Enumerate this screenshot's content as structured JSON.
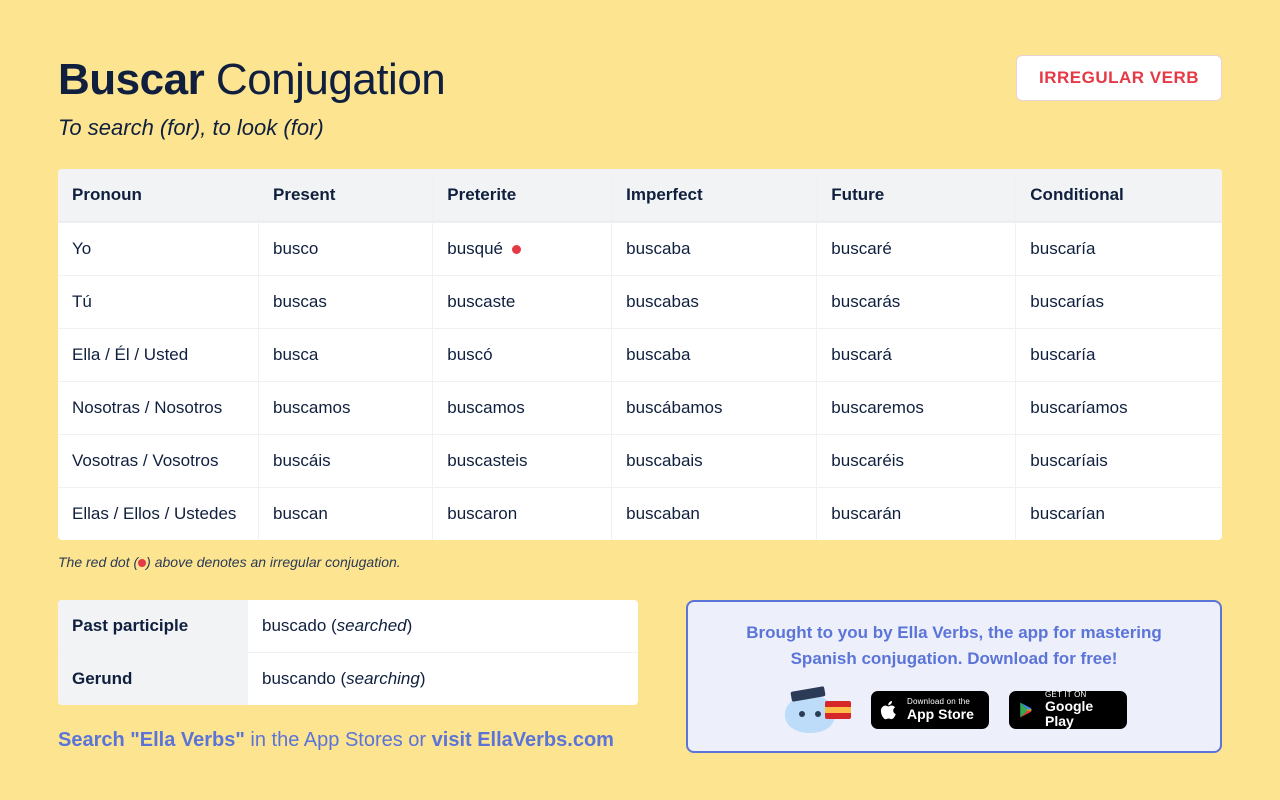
{
  "header": {
    "verb": "Buscar",
    "title_suffix": "Conjugation",
    "subtitle": "To search (for), to look (for)",
    "badge": "IRREGULAR VERB"
  },
  "table": {
    "headers": [
      "Pronoun",
      "Present",
      "Preterite",
      "Imperfect",
      "Future",
      "Conditional"
    ],
    "rows": [
      {
        "pronoun": "Yo",
        "present": "busco",
        "preterite": "busqué",
        "preterite_irregular": true,
        "imperfect": "buscaba",
        "future": "buscaré",
        "conditional": "buscaría"
      },
      {
        "pronoun": "Tú",
        "present": "buscas",
        "preterite": "buscaste",
        "preterite_irregular": false,
        "imperfect": "buscabas",
        "future": "buscarás",
        "conditional": "buscarías"
      },
      {
        "pronoun": "Ella / Él / Usted",
        "present": "busca",
        "preterite": "buscó",
        "preterite_irregular": false,
        "imperfect": "buscaba",
        "future": "buscará",
        "conditional": "buscaría"
      },
      {
        "pronoun": "Nosotras / Nosotros",
        "present": "buscamos",
        "preterite": "buscamos",
        "preterite_irregular": false,
        "imperfect": "buscábamos",
        "future": "buscaremos",
        "conditional": "buscaríamos"
      },
      {
        "pronoun": "Vosotras / Vosotros",
        "present": "buscáis",
        "preterite": "buscasteis",
        "preterite_irregular": false,
        "imperfect": "buscabais",
        "future": "buscaréis",
        "conditional": "buscaríais"
      },
      {
        "pronoun": "Ellas / Ellos / Ustedes",
        "present": "buscan",
        "preterite": "buscaron",
        "preterite_irregular": false,
        "imperfect": "buscaban",
        "future": "buscarán",
        "conditional": "buscarían"
      }
    ]
  },
  "footnote": {
    "before": "The red dot (",
    "after": ") above denotes an irregular conjugation."
  },
  "forms": {
    "past_participle_label": "Past participle",
    "past_participle_value": "buscado",
    "past_participle_translation": "searched",
    "gerund_label": "Gerund",
    "gerund_value": "buscando",
    "gerund_translation": "searching"
  },
  "promo": {
    "line1": "Brought to you by Ella Verbs, the app for mastering",
    "line2": "Spanish conjugation. Download for free!",
    "appstore_small": "Download on the",
    "appstore_big": "App Store",
    "play_small": "GET IT ON",
    "play_big": "Google Play"
  },
  "search_line": {
    "part1": "Search \"Ella Verbs\"",
    "part2": " in the App Stores or ",
    "part3": "visit EllaVerbs.com"
  }
}
